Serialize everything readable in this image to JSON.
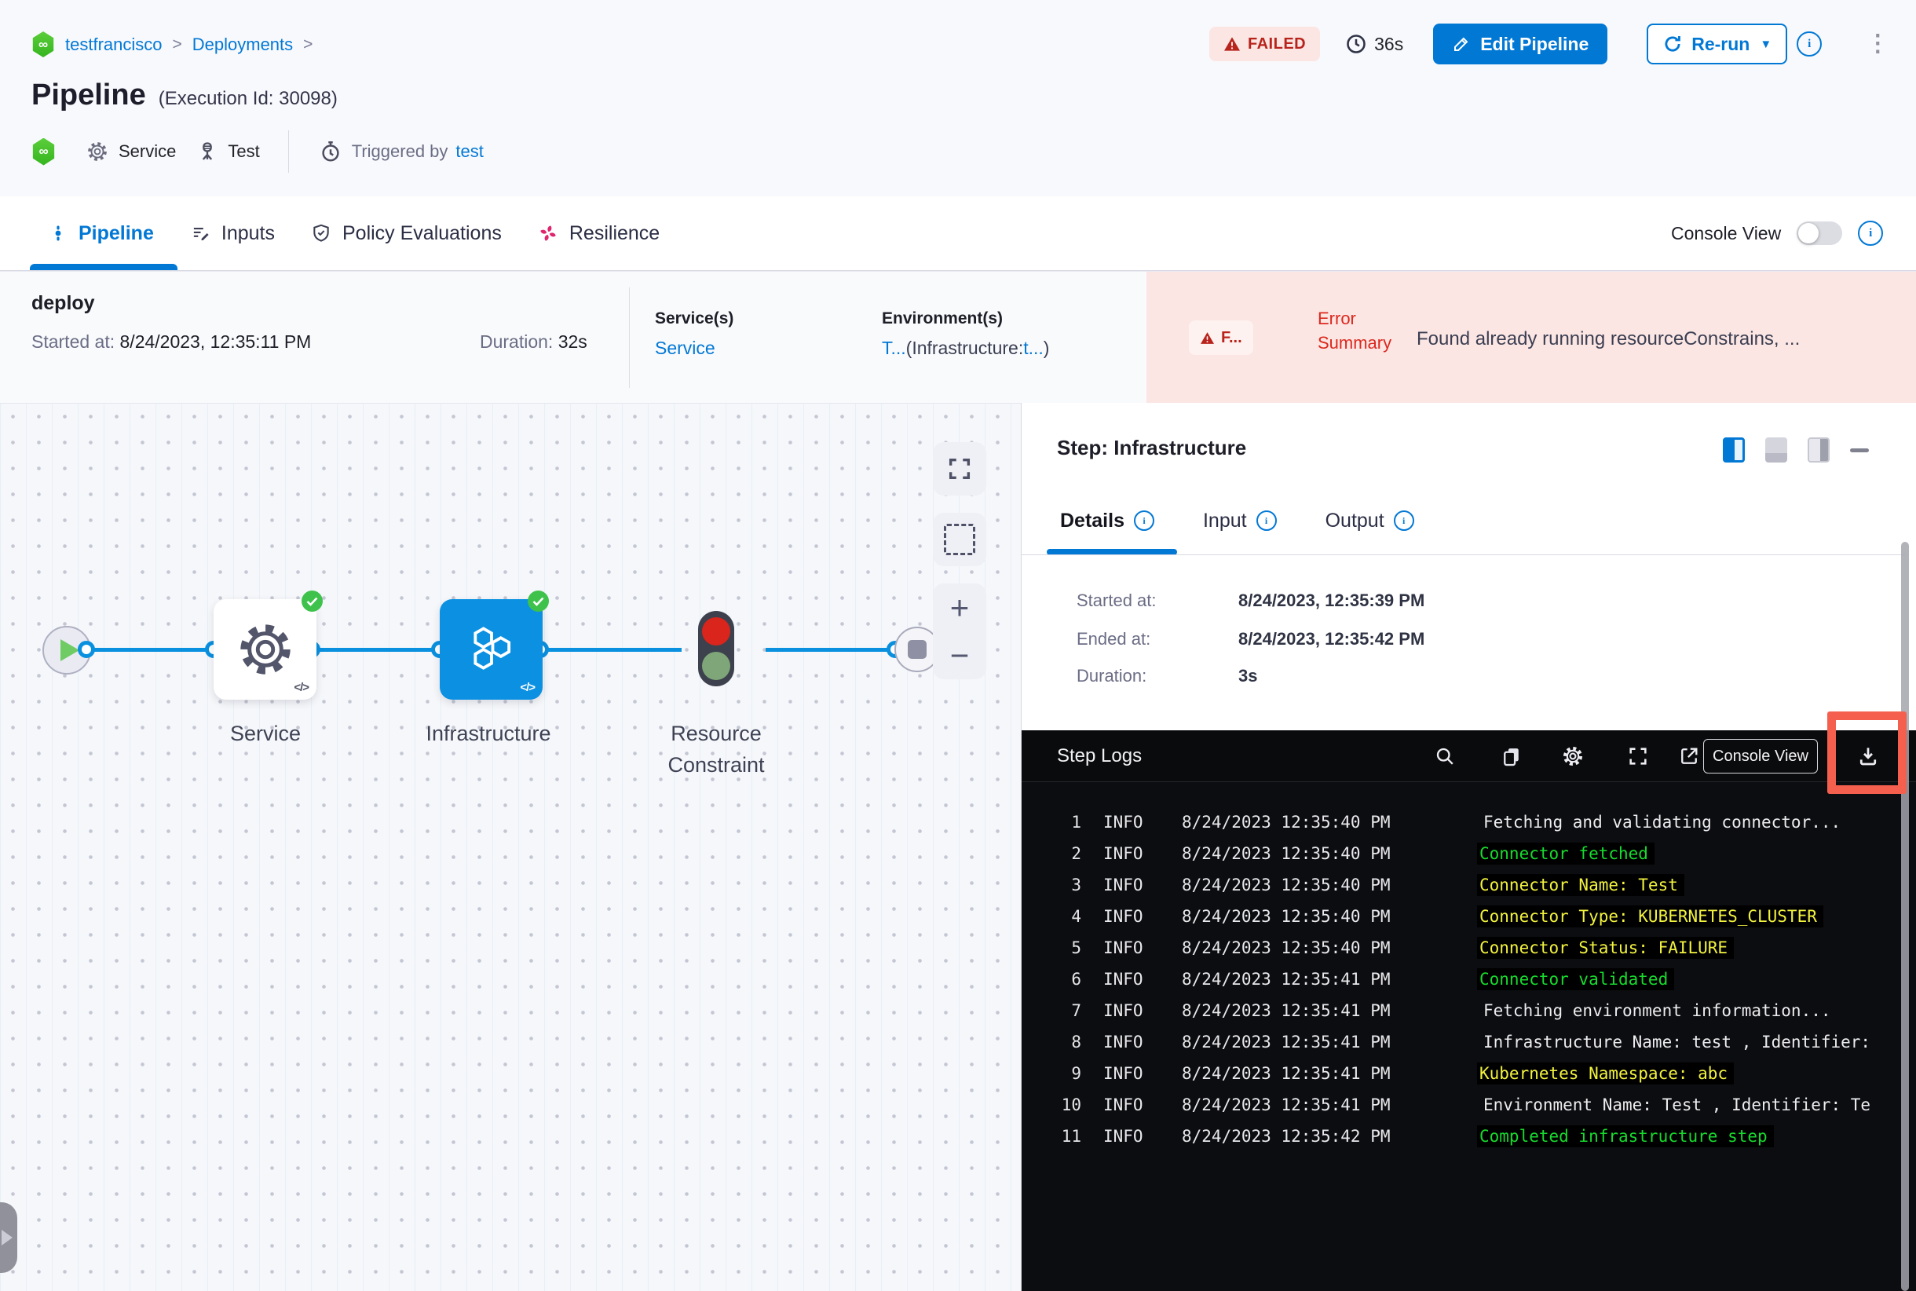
{
  "colors": {
    "accent": "#0278D5",
    "failed_red": "#B8231B",
    "error_band_pink": "#FBE6E3",
    "node_blue": "#0B90E2",
    "harness_green": "#43C021",
    "log_green": "#17DB2E",
    "log_yellow": "#F2F23F",
    "console_bg": "#0C0D10",
    "annotation_red": "#F4604D"
  },
  "header": {
    "breadcrumb": {
      "account": "testfrancisco",
      "separator": ">",
      "section": "Deployments"
    },
    "logo_glyph": "∞",
    "title": "Pipeline",
    "execution_id": "(Execution Id: 30098)",
    "status_badge": "FAILED",
    "elapsed": "36s",
    "edit_button": "Edit Pipeline",
    "rerun_button": "Re-run",
    "kebab_glyph": "⋮",
    "meta": {
      "service": "Service",
      "test": "Test",
      "triggered_by": "Triggered by",
      "trigger_user": "test"
    }
  },
  "tabs": {
    "pipeline": "Pipeline",
    "inputs": "Inputs",
    "policy": "Policy Evaluations",
    "resilience": "Resilience",
    "console_view": "Console View"
  },
  "stage": {
    "name": "deploy",
    "started_label": "Started at: ",
    "started_value": "8/24/2023, 12:35:11 PM",
    "duration_label": "Duration: ",
    "duration_value": "32s",
    "services_label": "Service(s)",
    "services_value": "Service",
    "environments_label": "Environment(s)",
    "env_value_t": "T...",
    "env_value_mid": "(Infrastructure:",
    "env_value_link": "t...",
    "env_value_close": ")",
    "error_badge": "F...",
    "error_label": "Error Summary",
    "error_message": "Found already running resourceConstrains, ..."
  },
  "graph": {
    "service_label": "Service",
    "infrastructure_label": "Infrastructure",
    "resource_constraint_label": "Resource Constraint",
    "code_badge": "</>",
    "zoom_in": "+",
    "zoom_out": "−"
  },
  "step_panel": {
    "title": "Step: Infrastructure",
    "tab_details": "Details",
    "tab_input": "Input",
    "tab_output": "Output",
    "details": [
      {
        "label": "Started at:",
        "value": "8/24/2023, 12:35:39 PM"
      },
      {
        "label": "Ended at:",
        "value": "8/24/2023, 12:35:42 PM"
      },
      {
        "label": "Duration:",
        "value": "3s"
      }
    ]
  },
  "logs": {
    "title": "Step Logs",
    "console_view_button": "Console View",
    "rows": [
      {
        "num": "1",
        "level": "INFO",
        "time": "8/24/2023 12:35:40 PM",
        "msg": "Fetching and validating connector...",
        "color": "white"
      },
      {
        "num": "2",
        "level": "INFO",
        "time": "8/24/2023 12:35:40 PM",
        "msg": "Connector fetched",
        "color": "green"
      },
      {
        "num": "3",
        "level": "INFO",
        "time": "8/24/2023 12:35:40 PM",
        "msg": "Connector Name: Test",
        "color": "yellow"
      },
      {
        "num": "4",
        "level": "INFO",
        "time": "8/24/2023 12:35:40 PM",
        "msg": "Connector Type: KUBERNETES_CLUSTER",
        "color": "yellow"
      },
      {
        "num": "5",
        "level": "INFO",
        "time": "8/24/2023 12:35:40 PM",
        "msg": "Connector Status: FAILURE",
        "color": "yellow"
      },
      {
        "num": "6",
        "level": "INFO",
        "time": "8/24/2023 12:35:41 PM",
        "msg": "Connector validated",
        "color": "green"
      },
      {
        "num": "7",
        "level": "INFO",
        "time": "8/24/2023 12:35:41 PM",
        "msg": "Fetching environment information...",
        "color": "white"
      },
      {
        "num": "8",
        "level": "INFO",
        "time": "8/24/2023 12:35:41 PM",
        "msg": "Infrastructure Name: test , Identifier:",
        "color": "white"
      },
      {
        "num": "9",
        "level": "INFO",
        "time": "8/24/2023 12:35:41 PM",
        "msg": "Kubernetes Namespace: abc",
        "color": "yellow"
      },
      {
        "num": "10",
        "level": "INFO",
        "time": "8/24/2023 12:35:41 PM",
        "msg": "Environment Name: Test , Identifier: Te",
        "color": "white"
      },
      {
        "num": "11",
        "level": "INFO",
        "time": "8/24/2023 12:35:42 PM",
        "msg": "Completed infrastructure step",
        "color": "green"
      }
    ]
  }
}
